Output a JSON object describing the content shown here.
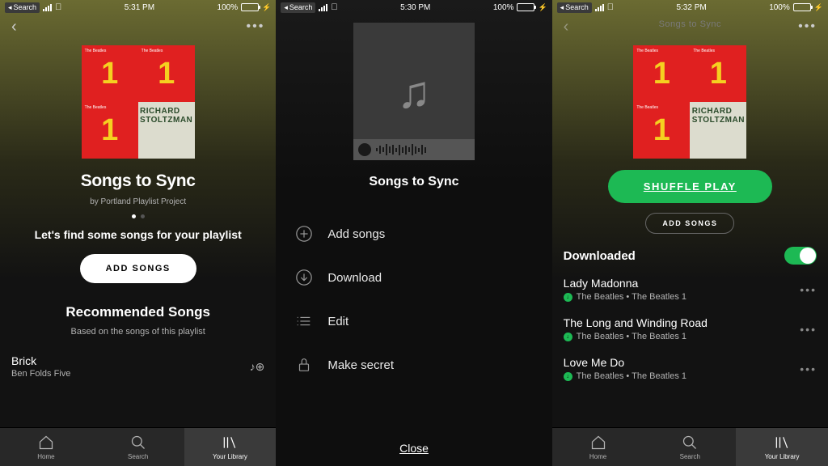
{
  "statusBar": {
    "backLabel": "Search",
    "battery": "100%",
    "times": [
      "5:31 PM",
      "5:30 PM",
      "5:32 PM"
    ]
  },
  "screen1": {
    "playlistTitle": "Songs to Sync",
    "by": "by Portland Playlist Project",
    "findSongs": "Let's find some songs for your playlist",
    "addSongs": "ADD SONGS",
    "recTitle": "Recommended Songs",
    "recSub": "Based on the songs of this playlist",
    "song": {
      "title": "Brick",
      "artist": "Ben Folds Five"
    },
    "album": {
      "band": "The Beatles",
      "number": "1",
      "richard": "RICHARD",
      "stoltzman": "STOLTZMAN"
    }
  },
  "screen2": {
    "title": "Songs to Sync",
    "menu": {
      "add": "Add songs",
      "download": "Download",
      "edit": "Edit",
      "secret": "Make secret"
    },
    "close": "Close"
  },
  "screen3": {
    "headerTitle": "Songs to Sync",
    "shuffle": "SHUFFLE PLAY",
    "addSongs": "ADD SONGS",
    "downloaded": "Downloaded",
    "tracks": [
      {
        "title": "Lady Madonna",
        "artist": "The Beatles • The Beatles 1"
      },
      {
        "title": "The Long and Winding Road",
        "artist": "The Beatles • The Beatles 1"
      },
      {
        "title": "Love Me Do",
        "artist": "The Beatles • The Beatles 1"
      }
    ]
  },
  "tabs": {
    "home": "Home",
    "search": "Search",
    "library": "Your Library"
  }
}
